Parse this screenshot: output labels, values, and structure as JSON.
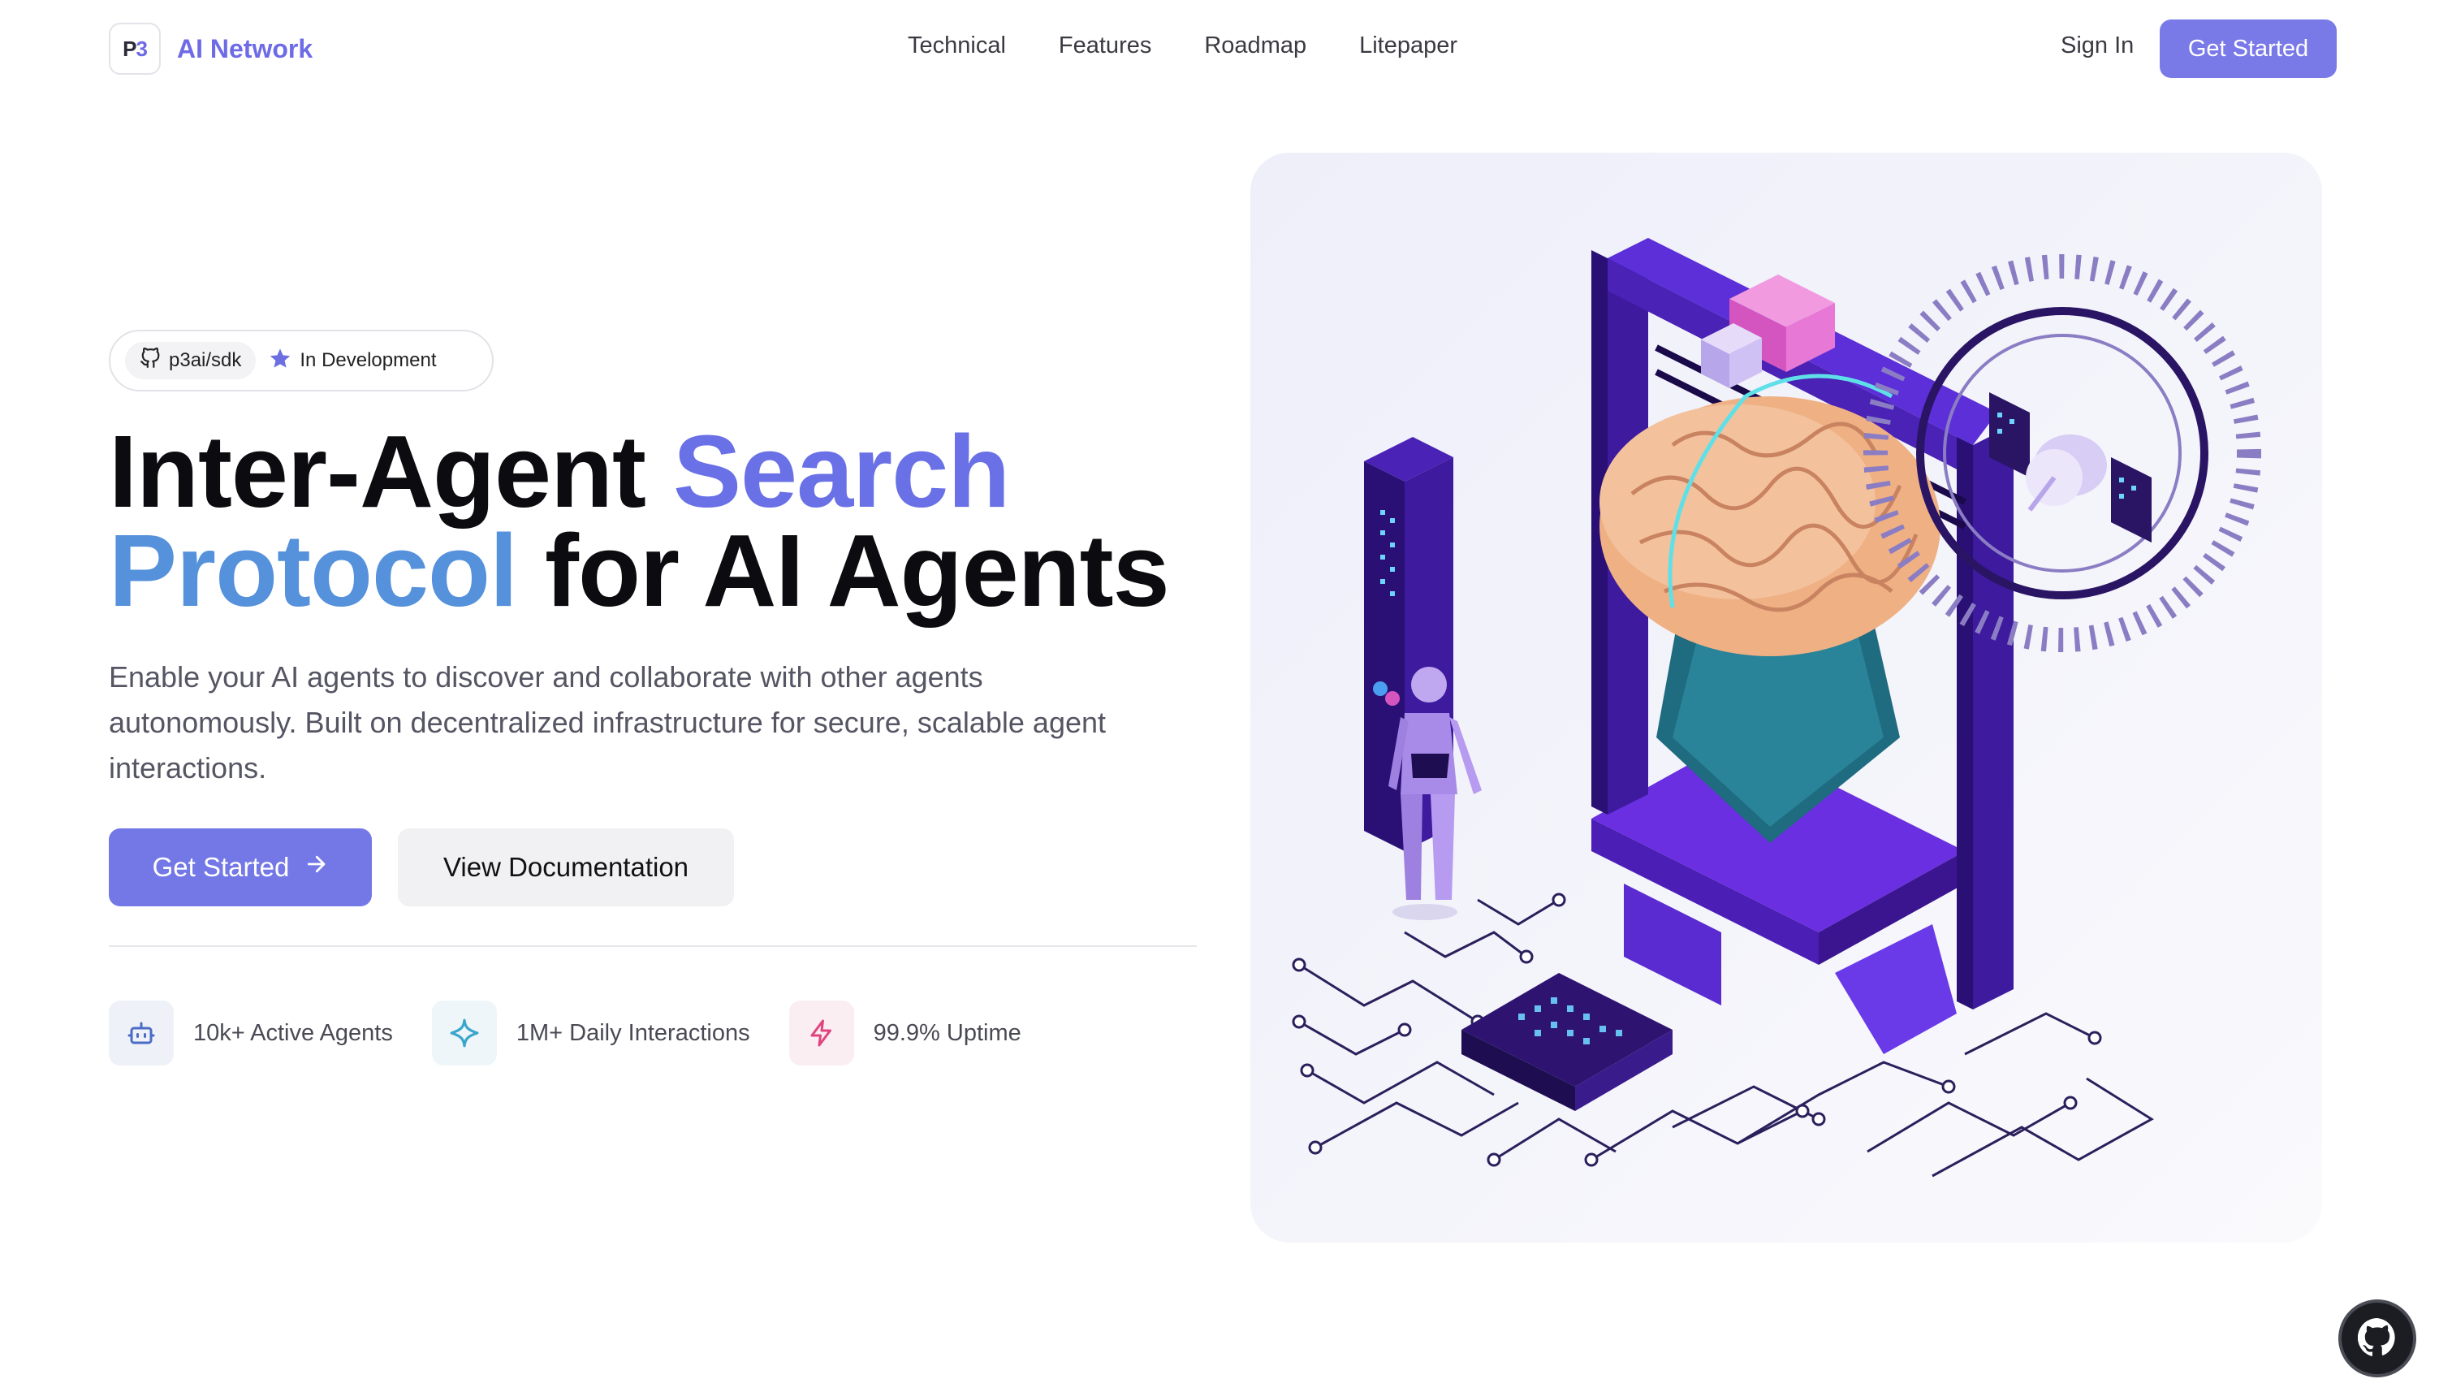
{
  "brand": {
    "logo_text": "P3",
    "name": "AI Network"
  },
  "nav": {
    "items": [
      "Technical",
      "Features",
      "Roadmap",
      "Litepaper"
    ]
  },
  "header_actions": {
    "sign_in": "Sign In",
    "get_started": "Get Started"
  },
  "badge": {
    "repo": "p3ai/sdk",
    "status": "In Development",
    "repo_icon": "github-icon",
    "status_icon": "star-icon"
  },
  "hero": {
    "title_part1": "Inter-Agent ",
    "title_highlight1": "Search",
    "title_highlight2": "Protocol",
    "title_part2": " for AI Agents",
    "subtitle": "Enable your AI agents to discover and collaborate with other agents autonomously. Built on decentralized infrastructure for secure, scalable agent interactions.",
    "primary_button": "Get Started",
    "secondary_button": "View Documentation"
  },
  "stats": [
    {
      "label": "10k+ Active Agents",
      "icon": "bot-icon"
    },
    {
      "label": "1M+ Daily Interactions",
      "icon": "sparkle-icon"
    },
    {
      "label": "99.9% Uptime",
      "icon": "zap-icon"
    }
  ],
  "colors": {
    "accent": "#7378e6",
    "title_gradient_start": "#6a70e6",
    "title_gradient_end": "#4fa3d9",
    "illustration_purple": "#4b22b3"
  }
}
